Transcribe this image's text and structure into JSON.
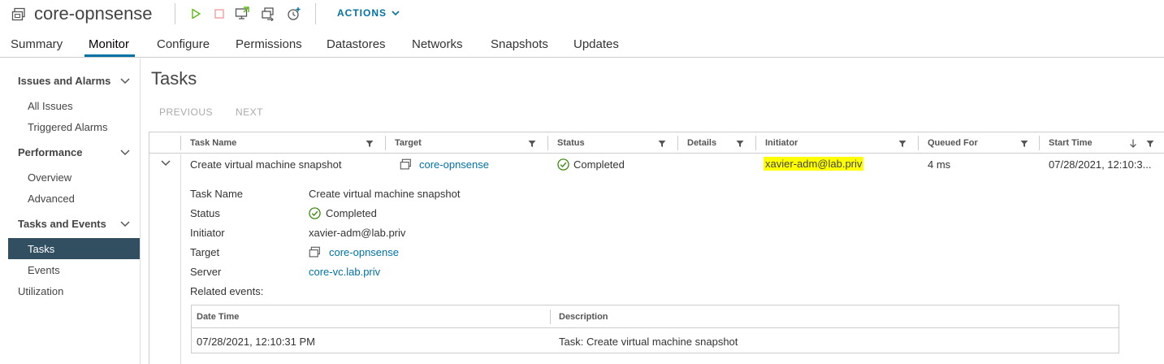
{
  "header": {
    "vm_name": "core-opnsense",
    "actions_label": "ACTIONS",
    "toolbar_icons": [
      "power-on-icon",
      "power-off-icon",
      "launch-console-icon",
      "migrate-icon",
      "snapshot-icon"
    ]
  },
  "tabs": [
    {
      "label": "Summary",
      "active": false
    },
    {
      "label": "Monitor",
      "active": true
    },
    {
      "label": "Configure",
      "active": false
    },
    {
      "label": "Permissions",
      "active": false
    },
    {
      "label": "Datastores",
      "active": false
    },
    {
      "label": "Networks",
      "active": false
    },
    {
      "label": "Snapshots",
      "active": false
    },
    {
      "label": "Updates",
      "active": false
    }
  ],
  "sidebar": {
    "groups": [
      {
        "label": "Issues and Alarms",
        "items": [
          "All Issues",
          "Triggered Alarms"
        ]
      },
      {
        "label": "Performance",
        "items": [
          "Overview",
          "Advanced"
        ]
      },
      {
        "label": "Tasks and Events",
        "items": [
          "Tasks",
          "Events"
        ]
      }
    ],
    "active_item": "Tasks",
    "utilization": "Utilization"
  },
  "main": {
    "title": "Tasks",
    "previous_label": "PREVIOUS",
    "next_label": "NEXT",
    "columns": [
      "Task Name",
      "Target",
      "Status",
      "Details",
      "Initiator",
      "Queued For",
      "Start Time"
    ],
    "row": {
      "task_name": "Create virtual machine snapshot",
      "target": "core-opnsense",
      "status": "Completed",
      "initiator": "xavier-adm@lab.priv",
      "queued_for": "4 ms",
      "start_time": "07/28/2021, 12:10:3..."
    },
    "details": {
      "task_name_label": "Task Name",
      "task_name_value": "Create virtual machine snapshot",
      "status_label": "Status",
      "status_value": "Completed",
      "initiator_label": "Initiator",
      "initiator_value": "xavier-adm@lab.priv",
      "target_label": "Target",
      "target_value": "core-opnsense",
      "server_label": "Server",
      "server_value": "core-vc.lab.priv",
      "related_events_label": "Related events:"
    },
    "related_events": {
      "columns": [
        "Date Time",
        "Description"
      ],
      "rows": [
        {
          "date_time": "07/28/2021, 12:10:31 PM",
          "description": "Task: Create virtual machine snapshot"
        }
      ]
    }
  },
  "colors": {
    "accent": "#0072a3",
    "sidebar_active": "#324f61",
    "highlight": "#ffff00",
    "success": "#2f8400",
    "power_on": "#5eb715",
    "power_off": "#e62700"
  }
}
